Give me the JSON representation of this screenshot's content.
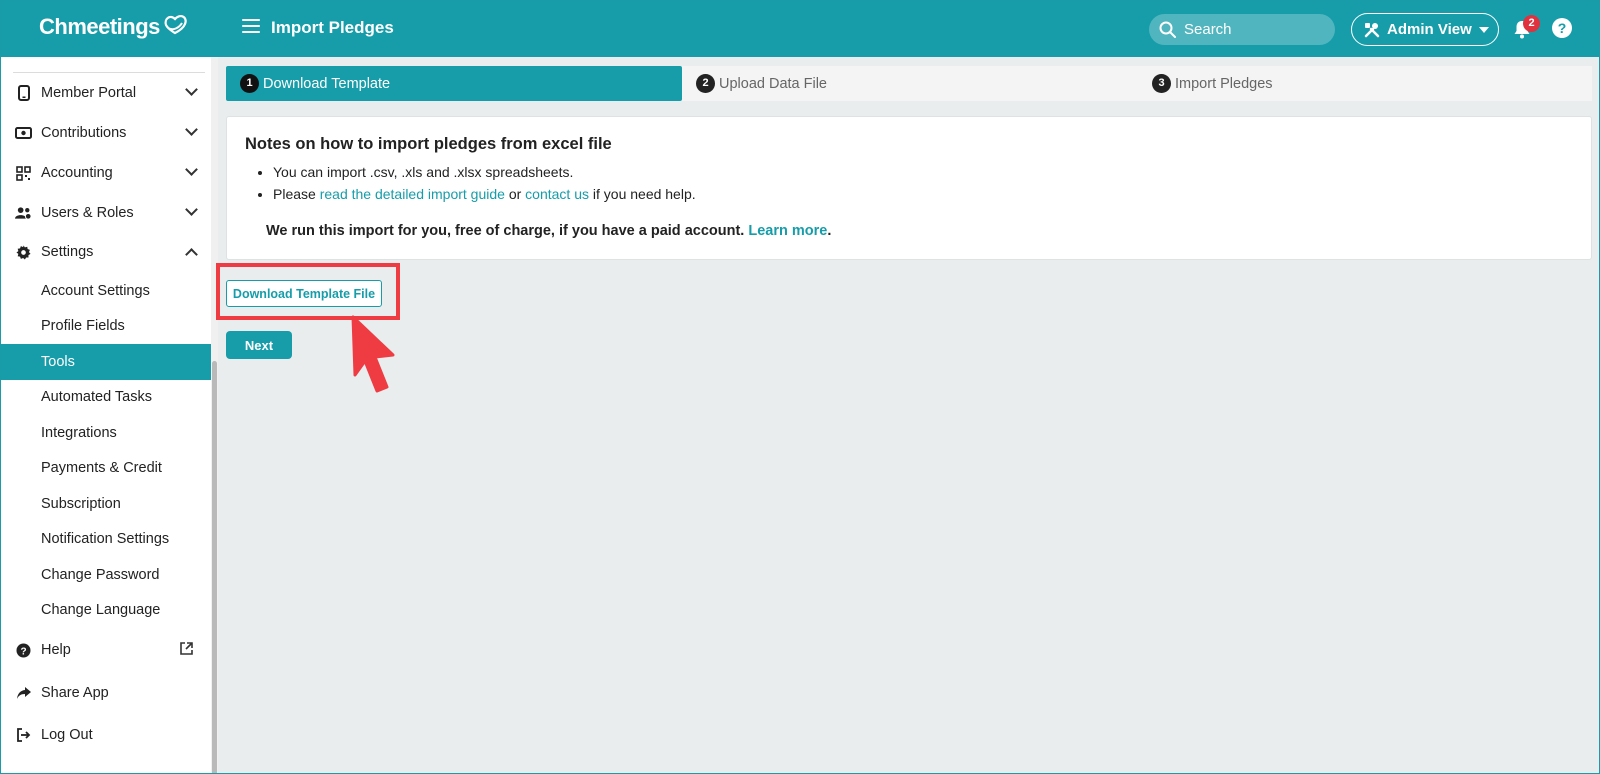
{
  "app": {
    "name": "Chmeetings"
  },
  "header": {
    "page_title": "Import Pledges",
    "search_placeholder": "Search",
    "admin_view_label": "Admin View",
    "notification_count": "2",
    "help_label": "?"
  },
  "sidebar": {
    "items": [
      {
        "label": "Member Portal",
        "icon": "phone-icon",
        "expandable": true
      },
      {
        "label": "Contributions",
        "icon": "money-icon",
        "expandable": true
      },
      {
        "label": "Accounting",
        "icon": "grid-icon",
        "expandable": true
      },
      {
        "label": "Users & Roles",
        "icon": "users-icon",
        "expandable": true
      },
      {
        "label": "Settings",
        "icon": "gear-icon",
        "expanded": true
      }
    ],
    "settings_subitems": [
      {
        "label": "Account Settings"
      },
      {
        "label": "Profile Fields"
      },
      {
        "label": "Tools",
        "active": true
      },
      {
        "label": "Automated Tasks"
      },
      {
        "label": "Integrations"
      },
      {
        "label": "Payments & Credit"
      },
      {
        "label": "Subscription"
      },
      {
        "label": "Notification Settings"
      },
      {
        "label": "Change Password"
      },
      {
        "label": "Change Language"
      }
    ],
    "footer_items": [
      {
        "label": "Help",
        "icon": "question-icon"
      },
      {
        "label": "Share App",
        "icon": "share-icon"
      },
      {
        "label": "Log Out",
        "icon": "logout-icon"
      }
    ]
  },
  "steps": [
    {
      "num": "1",
      "label": "Download Template",
      "active": true
    },
    {
      "num": "2",
      "label": "Upload Data File"
    },
    {
      "num": "3",
      "label": "Import Pledges"
    }
  ],
  "notes": {
    "title": "Notes on how to import pledges from excel file",
    "bullet1": "You can import .csv, .xls and .xlsx spreadsheets.",
    "bullet2_pre": "Please ",
    "bullet2_link1": "read the detailed import guide",
    "bullet2_mid": " or ",
    "bullet2_link2": "contact us",
    "bullet2_post": " if you need help.",
    "paid_text": "We run this import for you, free of charge, if you have a paid account. ",
    "paid_link": "Learn more",
    "paid_end": "."
  },
  "buttons": {
    "download_template": "Download Template File",
    "next": "Next"
  },
  "colors": {
    "brand": "#169da9",
    "highlight": "#ef3b42",
    "badge": "#e0313f"
  }
}
